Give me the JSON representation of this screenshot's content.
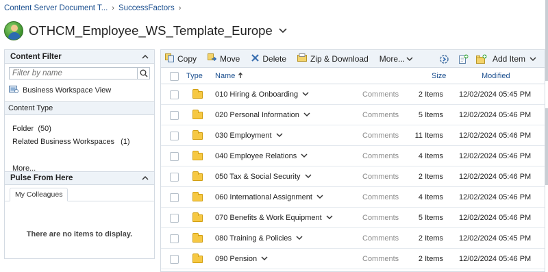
{
  "breadcrumb": {
    "items": [
      "Content Server Document T...",
      "SuccessFactors"
    ],
    "separator": "›"
  },
  "header": {
    "title": "OTHCM_Employee_WS_Template_Europe"
  },
  "content_filter": {
    "title": "Content Filter",
    "filter_placeholder": "Filter by name",
    "bw_view_label": "Business Workspace View",
    "content_type_header": "Content Type",
    "types": [
      {
        "label": "Folder",
        "count": "(50)"
      },
      {
        "label": "Related Business Workspaces",
        "count": "(1)"
      }
    ],
    "more_label": "More..."
  },
  "pulse": {
    "title": "Pulse From Here",
    "tab_label": "My Colleagues",
    "empty_text": "There are no items to display."
  },
  "toolbar": {
    "copy": "Copy",
    "move": "Move",
    "delete": "Delete",
    "zip": "Zip & Download",
    "more": "More...",
    "add_item": "Add Item"
  },
  "table": {
    "headers": {
      "type": "Type",
      "name": "Name",
      "size": "Size",
      "modified": "Modified"
    },
    "comments_label": "Comments",
    "rows": [
      {
        "name": "010 Hiring & Onboarding",
        "size": "2 Items",
        "modified": "12/02/2024 05:45 PM"
      },
      {
        "name": "020 Personal Information",
        "size": "5 Items",
        "modified": "12/02/2024 05:46 PM"
      },
      {
        "name": "030 Employment",
        "size": "11 Items",
        "modified": "12/02/2024 05:46 PM"
      },
      {
        "name": "040 Employee Relations",
        "size": "4 Items",
        "modified": "12/02/2024 05:46 PM"
      },
      {
        "name": "050 Tax & Social Security",
        "size": "2 Items",
        "modified": "12/02/2024 05:46 PM"
      },
      {
        "name": "060 International Assignment",
        "size": "4 Items",
        "modified": "12/02/2024 05:46 PM"
      },
      {
        "name": "070 Benefits & Work Equipment",
        "size": "5 Items",
        "modified": "12/02/2024 05:46 PM"
      },
      {
        "name": "080 Training & Policies",
        "size": "2 Items",
        "modified": "12/02/2024 05:45 PM"
      },
      {
        "name": "090 Pension",
        "size": "2 Items",
        "modified": "12/02/2024 05:46 PM"
      }
    ]
  },
  "colors": {
    "link": "#1b4f8f",
    "panel_header_bg": "#eef3f8",
    "folder": "#f6c843"
  }
}
